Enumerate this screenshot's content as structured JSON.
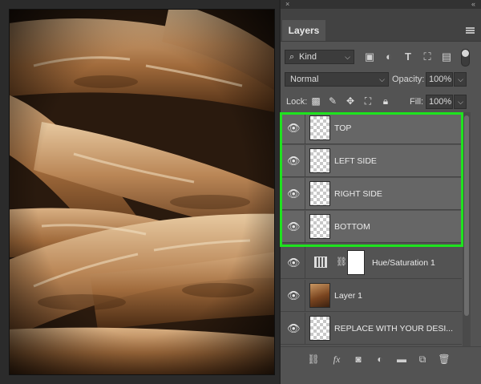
{
  "panel": {
    "close_glyph": "×",
    "collapse_glyph": "‹‹",
    "tab_label": "Layers"
  },
  "filter": {
    "kind_label": "Kind",
    "icons": [
      "image-filter-icon",
      "adjustment-filter-icon",
      "type-filter-icon",
      "shape-filter-icon",
      "smart-object-filter-icon",
      "filter-toggle-icon"
    ]
  },
  "blend": {
    "mode": "Normal",
    "opacity_label": "Opacity:",
    "opacity_value": "100%"
  },
  "lock": {
    "label": "Lock:",
    "icons": [
      "lock-transparency-icon",
      "lock-pixels-icon",
      "lock-position-icon",
      "lock-artboard-icon",
      "lock-all-icon"
    ],
    "fill_label": "Fill:",
    "fill_value": "100%"
  },
  "layers": [
    {
      "name": "TOP",
      "type": "transparent",
      "selected": true
    },
    {
      "name": "LEFT SIDE",
      "type": "transparent",
      "selected": true
    },
    {
      "name": "RIGHT SIDE",
      "type": "transparent",
      "selected": true
    },
    {
      "name": "BOTTOM",
      "type": "transparent",
      "selected": true
    },
    {
      "name": "Hue/Saturation 1",
      "type": "adjustment",
      "selected": false
    },
    {
      "name": "Layer 1",
      "type": "image",
      "selected": false
    },
    {
      "name": "REPLACE WITH YOUR DESI...",
      "type": "transparent",
      "selected": false
    }
  ],
  "bottom_icons": [
    "link-layers-icon",
    "fx-icon",
    "add-mask-icon",
    "new-adjustment-icon",
    "new-group-icon",
    "new-layer-icon",
    "delete-layer-icon"
  ],
  "highlight_color": "#1ee31e"
}
